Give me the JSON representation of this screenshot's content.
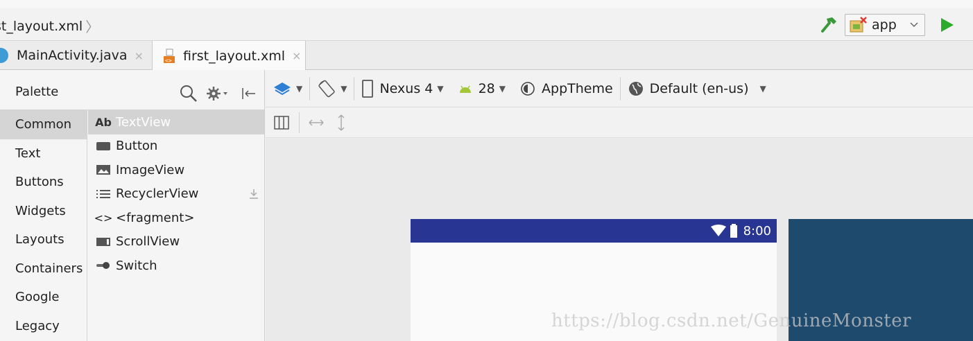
{
  "breadcrumb": {
    "file": "st_layout.xml",
    "separator": "〉"
  },
  "run_config": {
    "selected": "app"
  },
  "tabs": [
    {
      "label": "MainActivity.java",
      "close": "×"
    },
    {
      "label": "first_layout.xml",
      "close": "×"
    }
  ],
  "palette": {
    "title": "Palette",
    "categories": [
      "Common",
      "Text",
      "Buttons",
      "Widgets",
      "Layouts",
      "Containers",
      "Google",
      "Legacy"
    ],
    "widgets": [
      {
        "icon": "Ab",
        "label": "TextView"
      },
      {
        "label": "Button"
      },
      {
        "label": "ImageView"
      },
      {
        "label": "RecyclerView"
      },
      {
        "icon": "<>",
        "label": "<fragment>"
      },
      {
        "label": "ScrollView"
      },
      {
        "label": "Switch"
      }
    ]
  },
  "design_toolbar": {
    "device": "Nexus 4",
    "api_level": "28",
    "theme": "AppTheme",
    "locale": "Default (en-us)"
  },
  "preview": {
    "status_time": "8:00"
  },
  "watermark": "https://blog.csdn.net/GenuineMonster",
  "colors": {
    "status_bar": "#283593",
    "blueprint": "#1e4a6e",
    "run_green": "#2bab2b",
    "android_green": "#a4c639",
    "layers_blue": "#2d7fd6"
  }
}
